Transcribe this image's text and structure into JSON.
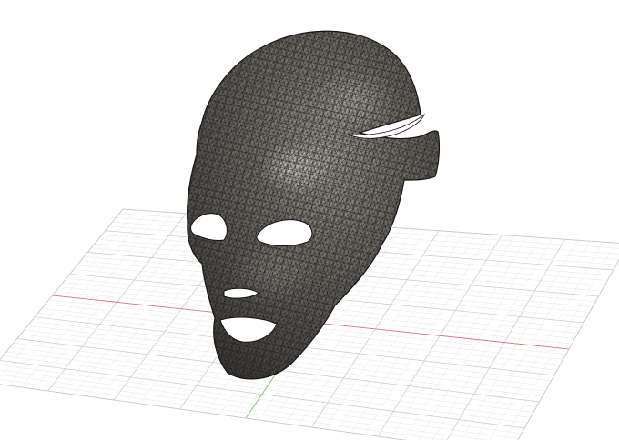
{
  "viewport": {
    "background_color": "#ffffff"
  },
  "grid": {
    "minor_line_color": "#e3e3e3",
    "major_line_color": "#c8c8c8",
    "x_axis_color": "#e06a6a",
    "y_axis_color": "#6ac46a",
    "tick_labels": [
      "",
      "",
      "",
      "",
      ""
    ]
  },
  "model": {
    "name": "face-mask-mesh",
    "render_mode": "wireframe-shaded",
    "surface_color": "#6b6760",
    "highlight_color": "#bdb8ae",
    "wire_color": "#1c1c1c"
  },
  "icons": {
    "mesh": "mask-mesh-icon"
  }
}
